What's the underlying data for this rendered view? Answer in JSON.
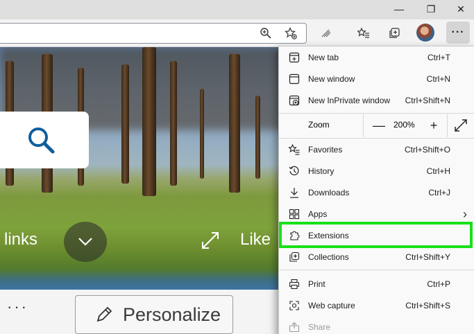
{
  "window_controls": {
    "minimize": "—",
    "maximize": "❐",
    "close": "✕"
  },
  "toolbar": {
    "more_label": "···",
    "icons": [
      "zoom-icon",
      "add-favorite-icon",
      "read-aloud-icon",
      "favorites-icon",
      "collections-icon",
      "profile-avatar",
      "more-icon"
    ]
  },
  "page": {
    "links_label": "links",
    "like_label": "Like",
    "more_dots": "···",
    "personalize_label": "Personalize"
  },
  "menu": {
    "items": [
      {
        "label": "New tab",
        "shortcut": "Ctrl+T",
        "icon": "new-tab-icon"
      },
      {
        "label": "New window",
        "shortcut": "Ctrl+N",
        "icon": "new-window-icon"
      },
      {
        "label": "New InPrivate window",
        "shortcut": "Ctrl+Shift+N",
        "icon": "inprivate-icon"
      },
      {
        "label": "Favorites",
        "shortcut": "Ctrl+Shift+O",
        "icon": "favorites-icon"
      },
      {
        "label": "History",
        "shortcut": "Ctrl+H",
        "icon": "history-icon"
      },
      {
        "label": "Downloads",
        "shortcut": "Ctrl+J",
        "icon": "download-icon"
      },
      {
        "label": "Apps",
        "shortcut": "",
        "icon": "apps-icon",
        "submenu": "›"
      },
      {
        "label": "Extensions",
        "shortcut": "",
        "icon": "extensions-icon"
      },
      {
        "label": "Collections",
        "shortcut": "Ctrl+Shift+Y",
        "icon": "collections-icon"
      },
      {
        "label": "Print",
        "shortcut": "Ctrl+P",
        "icon": "print-icon"
      },
      {
        "label": "Web capture",
        "shortcut": "Ctrl+Shift+S",
        "icon": "web-capture-icon"
      },
      {
        "label": "Share",
        "shortcut": "",
        "icon": "share-icon",
        "disabled": true
      }
    ],
    "zoom": {
      "label": "Zoom",
      "minus": "—",
      "value": "200%",
      "plus": "+"
    }
  },
  "colors": {
    "highlight": "#19e01a",
    "accent": "#0f5e9c"
  }
}
